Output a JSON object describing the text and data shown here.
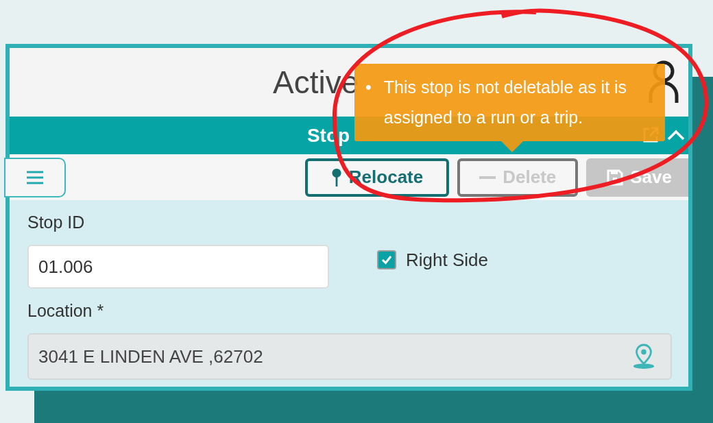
{
  "header": {
    "title": "Active"
  },
  "tooltip": {
    "bullet": "•",
    "items": [
      "This stop is not deletable as it is assigned to a run or a trip."
    ]
  },
  "panel": {
    "title": "Stop",
    "expanded": true
  },
  "toolbar": {
    "buttons": [
      {
        "label": "Relocate",
        "kind": "relocate",
        "disabled": false,
        "focused": true
      },
      {
        "label": "Delete",
        "kind": "delete",
        "disabled": true,
        "focused": true
      },
      {
        "label": "Save",
        "kind": "save",
        "disabled": true,
        "focused": false
      }
    ]
  },
  "form": {
    "stop_id": {
      "label": "Stop ID",
      "value": "01.006"
    },
    "right_side": {
      "label": "Right Side",
      "checked": true
    },
    "location": {
      "label": "Location *",
      "value": "3041 E LINDEN AVE ,62702",
      "disabled": true
    }
  }
}
